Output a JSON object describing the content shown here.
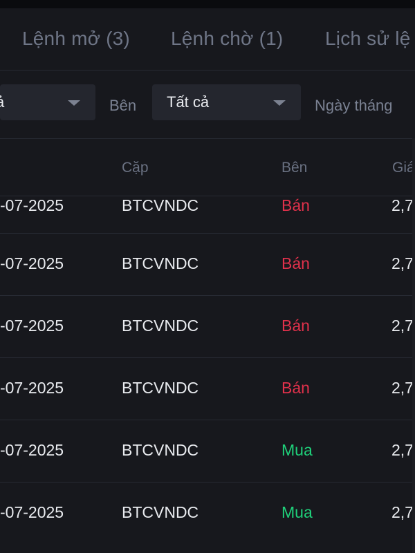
{
  "tabs": [
    {
      "label": "Lệnh mở (3)"
    },
    {
      "label": "Lệnh chờ (1)"
    },
    {
      "label": "Lịch sử lệ"
    }
  ],
  "filters": {
    "first_value": "ả",
    "side_label": "Bên",
    "side_value": "Tất cả",
    "date_label": "Ngày tháng"
  },
  "table": {
    "headers": {
      "pair": "Cặp",
      "side": "Bên",
      "price": "Giá"
    },
    "rows": [
      {
        "date": "-07-2025",
        "pair": "BTCVNDC",
        "side": "Bán",
        "price": "2,7"
      },
      {
        "date": "-07-2025",
        "pair": "BTCVNDC",
        "side": "Bán",
        "price": "2,7"
      },
      {
        "date": "-07-2025",
        "pair": "BTCVNDC",
        "side": "Bán",
        "price": "2,7"
      },
      {
        "date": "-07-2025",
        "pair": "BTCVNDC",
        "side": "Bán",
        "price": "2,7"
      },
      {
        "date": "-07-2025",
        "pair": "BTCVNDC",
        "side": "Mua",
        "price": "2,7"
      },
      {
        "date": "-07-2025",
        "pair": "BTCVNDC",
        "side": "Mua",
        "price": "2,7"
      }
    ]
  },
  "colors": {
    "sell": "#e0314b",
    "buy": "#1fd07a",
    "background": "#17181d"
  }
}
